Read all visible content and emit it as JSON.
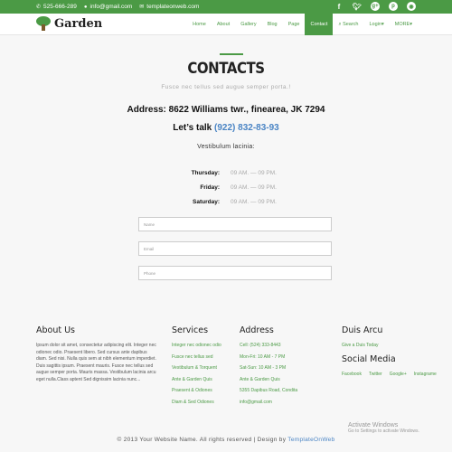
{
  "topbar": {
    "phone": "525-666-289",
    "email": "info@gmail.com",
    "website": "templateonweb.com",
    "social_icons": [
      "facebook-icon",
      "twitter-icon",
      "google-icon",
      "pinterest-icon",
      "rss-icon"
    ],
    "color": "#4b9a45"
  },
  "navbar": {
    "brand": "Garden",
    "menu": [
      "Home",
      "About",
      "Gallery",
      "Blog",
      "Page",
      "Contact",
      "Search",
      "Login",
      "MORE"
    ],
    "active": "Contact"
  },
  "contact": {
    "title": "CONTACTS",
    "subtitle": "Fusce nec tellus sed augue semper porta.!",
    "address": "Address: 8622 Williams twr., finearea, JK 7294",
    "talk_label": "Let’s talk",
    "phone": "(922) 832-83-93",
    "vestibulum": "Vestibulum lacinia:",
    "hours": [
      {
        "day": "Thursday:",
        "time": "09 AM. — 09 PM."
      },
      {
        "day": "Friday:",
        "time": "09 AM. — 09 PM."
      },
      {
        "day": "Saturday:",
        "time": "09 AM. — 09 PM."
      }
    ],
    "fields": {
      "name": "Name",
      "email": "Email",
      "phone": "Phone"
    }
  },
  "footer": {
    "about": {
      "title": "About Us",
      "text": "Ipsum dolor sit amet, consectetur adipiscing elit. Integer nec odionec odio. Praesent libero. Sed cursus ante dapibus diam. Sed nisi. Nulla quis sem at nibh elementum imperdiet. Duis sagittis ipsum. Praesent mauris. Fusce nec tellus sed augue semper porta. Mauris massa. Vestibulum lacinia arcu eget nulla.Class aptent Sed dignissim lacinia nunc..."
    },
    "services": {
      "title": "Services",
      "items": [
        "Integer nec odionec odio",
        "Fusce nec tellus sed",
        "Vestibulum & Torquent",
        "Ante & Garden Quis",
        "Praesent & Odiones",
        "Diam & Sed Odiones"
      ]
    },
    "address": {
      "title": "Address",
      "lines": [
        "Cell: (524) 333-8443",
        "Mon-Fri: 10 AM - 7 PM",
        "Sat-Sun: 10 AM - 3 PM",
        "Ante & Garden Quis",
        "5355 Dapibus Road, Condita",
        "info@gmail.com"
      ]
    },
    "duis": {
      "title": "Duis Arcu",
      "link": "Give a Duis Today",
      "social_title": "Social Media",
      "social": [
        "Facebook",
        "Twitter",
        "Google+",
        "Instagrame"
      ]
    }
  },
  "copyright": {
    "text": "© 2013 Your Website Name. All rights reserved | Design by",
    "link": "TemplateOnWeb"
  },
  "watermark": {
    "title": "Activate Windows",
    "sub": "Go to Settings to activate Windows."
  }
}
